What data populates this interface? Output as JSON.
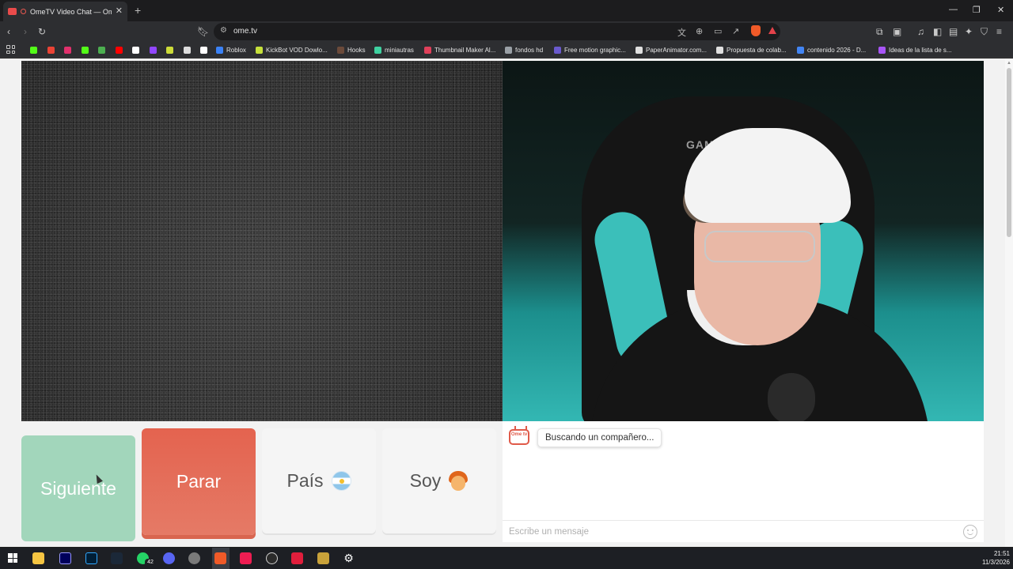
{
  "browser": {
    "tab_title": "OmeTV Video Chat — Omeg",
    "tab_close": "✕",
    "new_tab": "+",
    "url": "ome.tv",
    "window_controls": {
      "minimize": "—",
      "maximize": "❐",
      "close": "✕"
    }
  },
  "bookmarks": [
    {
      "label": "",
      "icon": "kick-icon",
      "color": "#53fc18"
    },
    {
      "label": "",
      "icon": "gmail-icon",
      "color": "#ea4335"
    },
    {
      "label": "",
      "icon": "instagram-icon",
      "color": "#e1306c"
    },
    {
      "label": "",
      "icon": "kick-icon",
      "color": "#53fc18"
    },
    {
      "label": "",
      "icon": "bookmark-icon",
      "color": "#4caf50"
    },
    {
      "label": "",
      "icon": "youtube-icon",
      "color": "#ff0000"
    },
    {
      "label": "",
      "icon": "x-icon",
      "color": "#ffffff"
    },
    {
      "label": "",
      "icon": "twitch-icon",
      "color": "#9146ff"
    },
    {
      "label": "",
      "icon": "bookmark-icon",
      "color": "#cddc39"
    },
    {
      "label": "",
      "icon": "chatgpt-icon",
      "color": "#dddddd"
    },
    {
      "label": "",
      "icon": "tiktok-icon",
      "color": "#ffffff"
    },
    {
      "label": "Roblox",
      "icon": "roblox-icon",
      "color": "#3b82f6"
    },
    {
      "label": "KickBot VOD Dowlo...",
      "icon": "kickbot-icon",
      "color": "#c6e03b"
    },
    {
      "label": "Hooks",
      "icon": "hooks-icon",
      "color": "#6b4a3a"
    },
    {
      "label": "miniautras",
      "icon": "miniautras-icon",
      "color": "#3fd1a0"
    },
    {
      "label": "Thumbnail Maker Al...",
      "icon": "thumbnail-icon",
      "color": "#e0405a"
    },
    {
      "label": "fondos hd",
      "icon": "fondos-icon",
      "color": "#9aa0a6"
    },
    {
      "label": "Free motion graphic...",
      "icon": "motion-icon",
      "color": "#6a5acd"
    },
    {
      "label": "PaperAnimator.com...",
      "icon": "paper-icon",
      "color": "#e0e0e0"
    },
    {
      "label": "Propuesta de colab...",
      "icon": "github-icon",
      "color": "#e0e0e0"
    },
    {
      "label": "contenido 2026 - D...",
      "icon": "docs-icon",
      "color": "#4285f4"
    },
    {
      "label": "Ideas de la lista de s...",
      "icon": "ideas-icon",
      "color": "#a855f7"
    }
  ],
  "video": {
    "chair_label": "GAME"
  },
  "controls": {
    "next_label": "Siguiente",
    "stop_label": "Parar",
    "country_label": "País",
    "gender_label": "Soy"
  },
  "chat": {
    "logo_text": "Ome tv",
    "status_message": "Buscando un compañero...",
    "input_placeholder": "Escribe un mensaje"
  },
  "taskbar": {
    "whatsapp_badge": "42",
    "time": "21:51",
    "date": "11/3/2026"
  },
  "colors": {
    "next_button": "#a2d6bb",
    "stop_button": "#e4634f",
    "neutral_button": "#f5f5f5",
    "brand_red": "#e05a49"
  }
}
